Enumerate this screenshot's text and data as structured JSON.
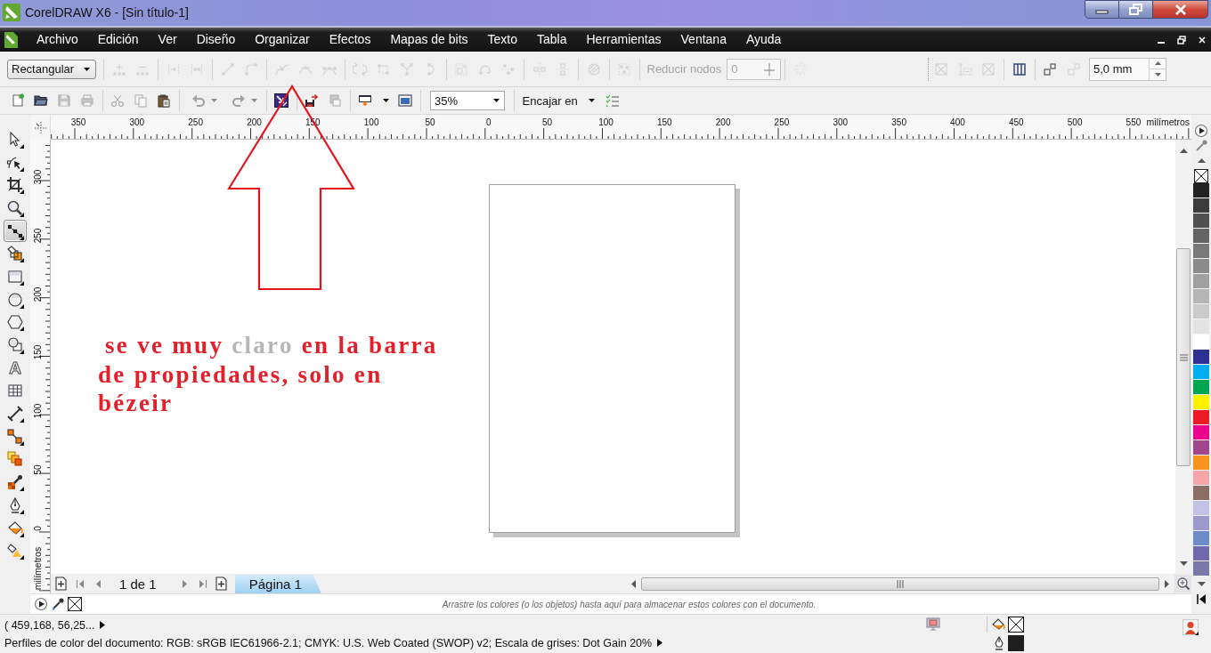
{
  "window": {
    "title": "CorelDRAW X6 - [Sin título-1]"
  },
  "menu_bar": {
    "items": [
      {
        "label": "Archivo"
      },
      {
        "label": "Edición"
      },
      {
        "label": "Ver"
      },
      {
        "label": "Diseño"
      },
      {
        "label": "Organizar"
      },
      {
        "label": "Efectos"
      },
      {
        "label": "Mapas de bits"
      },
      {
        "label": "Texto"
      },
      {
        "label": "Tabla"
      },
      {
        "label": "Herramientas"
      },
      {
        "label": "Ventana"
      },
      {
        "label": "Ayuda"
      }
    ]
  },
  "property_bar": {
    "selection_mode": {
      "value": "Rectangular"
    },
    "node_groups": [
      [
        {
          "disabled": true
        },
        {
          "disabled": true
        }
      ],
      [
        {
          "disabled": true
        },
        {
          "disabled": true
        }
      ],
      [
        {
          "disabled": true
        },
        {
          "disabled": true
        }
      ],
      [
        {
          "disabled": true
        },
        {
          "disabled": true
        },
        {
          "disabled": true
        }
      ],
      [
        {
          "disabled": true
        },
        {
          "disabled": true
        },
        {
          "disabled": true
        },
        {
          "disabled": true
        }
      ],
      [
        {
          "disabled": true
        },
        {
          "disabled": true
        },
        {
          "disabled": true
        }
      ],
      [
        {
          "disabled": true
        },
        {
          "disabled": true
        }
      ],
      [
        {
          "disabled": true
        }
      ],
      [
        {
          "disabled": true
        }
      ]
    ],
    "reduce_nodes": {
      "label": "Reducir nodos",
      "value": "0",
      "disabled": true
    },
    "trailing_tools": [
      {
        "disabled": true
      }
    ],
    "frame_groups": [
      [
        {
          "disabled": true
        },
        {
          "disabled": true
        },
        {
          "disabled": true
        }
      ],
      [
        {
          "disabled": false
        }
      ],
      [
        {
          "disabled": false
        },
        {
          "disabled": true
        }
      ]
    ],
    "nudge": {
      "value": "5,0 mm"
    }
  },
  "standard_toolbar": {
    "button_groups": [
      [
        {
          "disabled": false
        },
        {
          "disabled": false
        },
        {
          "disabled": true
        },
        {
          "disabled": true
        }
      ],
      [
        {
          "disabled": true
        },
        {
          "disabled": true
        },
        {
          "disabled": false
        }
      ],
      [
        {
          "disabled": true
        },
        {
          "disabled": true
        }
      ],
      [
        {
          "disabled": false
        }
      ],
      [
        {
          "disabled": false
        },
        {
          "disabled": true
        }
      ],
      [
        {
          "disabled": false
        },
        {
          "disabled": false
        }
      ]
    ],
    "zoom_level": {
      "value": "35%"
    },
    "snap_to": {
      "label": "Encajar en"
    }
  },
  "toolbox": {
    "tools": [
      {
        "selected": false
      },
      {
        "selected": false
      },
      {
        "selected": false
      },
      {
        "selected": false
      },
      {
        "selected": true
      },
      {
        "selected": false
      },
      {
        "selected": false
      },
      {
        "selected": false
      },
      {
        "selected": false
      },
      {
        "selected": false
      },
      {
        "selected": false,
        "glyph": "A"
      },
      {
        "selected": false
      },
      {
        "selected": false
      },
      {
        "selected": false
      },
      {
        "selected": false
      },
      {
        "selected": false
      },
      {
        "selected": false
      },
      {
        "selected": false
      },
      {
        "selected": false
      }
    ]
  },
  "rulers": {
    "horizontal": {
      "labels": [
        "350",
        "300",
        "250",
        "200",
        "150",
        "100",
        "50",
        "0",
        "50",
        "100",
        "150",
        "200",
        "250",
        "300",
        "350",
        "400",
        "450",
        "500",
        "550"
      ],
      "unit": "milímetros"
    },
    "vertical": {
      "labels": [
        "300",
        "250",
        "200",
        "150",
        "100",
        "50",
        "0"
      ],
      "unit": "milímetros"
    }
  },
  "annotation": {
    "segments": [
      {
        "text": "se ve muy ",
        "faded": false
      },
      {
        "text": "claro",
        "faded": true
      },
      {
        "text": " en la barra de propiedades, solo en bézeir",
        "faded": false
      }
    ]
  },
  "page_navigator": {
    "counter": "1 de 1",
    "tabs": [
      {
        "label": "Página 1",
        "selected": true
      }
    ]
  },
  "color_palette": {
    "swatches": [
      {
        "color": "#222222"
      },
      {
        "color": "#3c3c3c"
      },
      {
        "color": "#505050"
      },
      {
        "color": "#646464"
      },
      {
        "color": "#787878"
      },
      {
        "color": "#8c8c8c"
      },
      {
        "color": "#a0a0a0"
      },
      {
        "color": "#b5b5b5"
      },
      {
        "color": "#cacaca"
      },
      {
        "color": "#e3e3e3"
      },
      {
        "color": "#ffffff"
      },
      {
        "color": "#2e3192"
      },
      {
        "color": "#00aeef"
      },
      {
        "color": "#00a651"
      },
      {
        "color": "#fff200"
      },
      {
        "color": "#ed1c24"
      },
      {
        "color": "#ec008c"
      },
      {
        "color": "#a0468c"
      },
      {
        "color": "#f7941d"
      },
      {
        "color": "#f5a6a8"
      },
      {
        "color": "#8b6e63"
      },
      {
        "color": "#c4c2e4"
      },
      {
        "color": "#9c99cc"
      },
      {
        "color": "#6c8cc8"
      },
      {
        "color": "#7068ac"
      },
      {
        "color": "#7a78a8"
      }
    ]
  },
  "document_palette": {
    "hint": "Arrastre los colores (o los objetos) hasta aquí para almacenar estos colores con el documento."
  },
  "status_bar": {
    "cursor_position": "( 459,168, 56,25...",
    "color_profiles": "Perfiles de color del documento: RGB: sRGB IEC61966-2.1; CMYK: U.S. Web Coated (SWOP) v2; Escala de grises: Dot Gain 20%",
    "fill": {
      "kind": "none"
    },
    "outline": {
      "kind": "solid",
      "color": "#1e1e1e"
    }
  }
}
